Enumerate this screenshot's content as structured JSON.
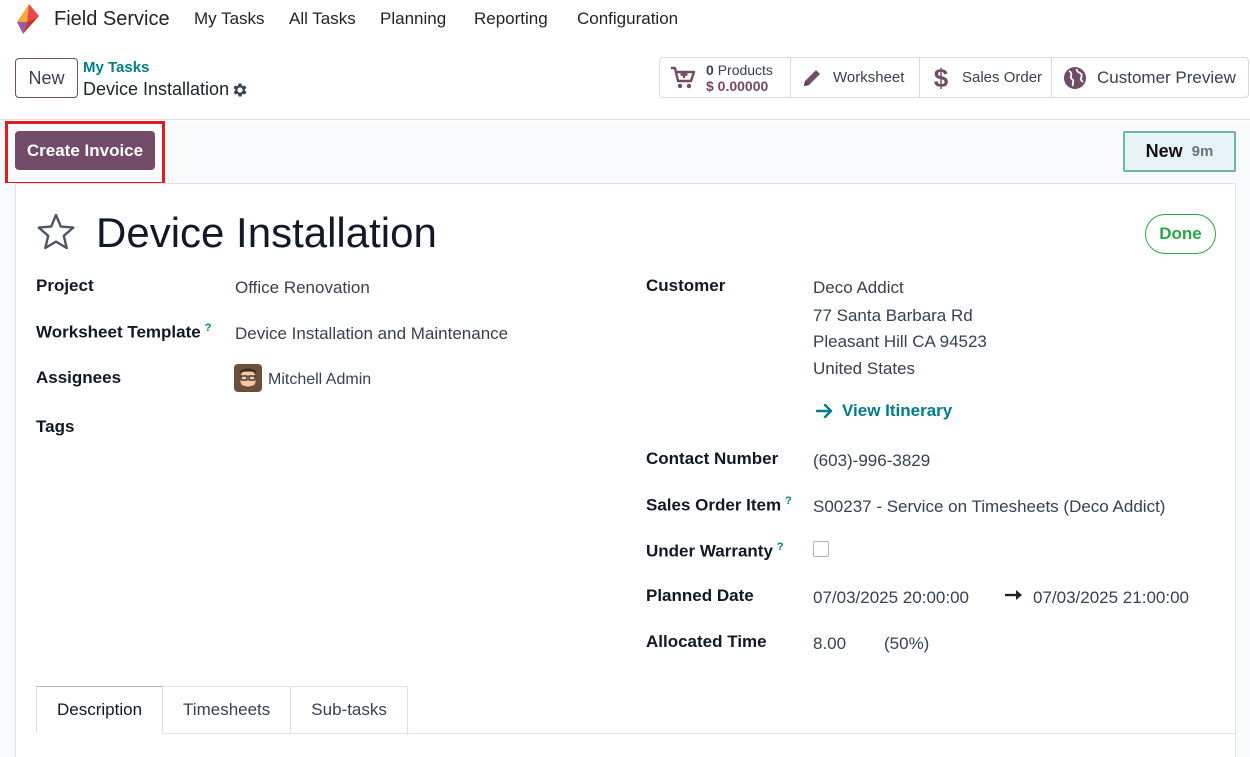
{
  "app": {
    "name": "Field Service",
    "menu": [
      "My Tasks",
      "All Tasks",
      "Planning",
      "Reporting",
      "Configuration"
    ]
  },
  "control_panel": {
    "new_label": "New",
    "breadcrumb_parent": "My Tasks",
    "breadcrumb_current": "Device Installation",
    "stats": {
      "products_count": "0",
      "products_label": "Products",
      "products_amount": "$ 0.00000",
      "worksheet": "Worksheet",
      "sales_order": "Sales Order",
      "customer_preview": "Customer Preview"
    }
  },
  "status": {
    "create_invoice": "Create Invoice",
    "stage": "New",
    "stage_duration": "9m"
  },
  "form": {
    "title": "Device Installation",
    "state": "Done",
    "left": {
      "project_label": "Project",
      "project": "Office Renovation",
      "worksheet_template_label": "Worksheet Template",
      "worksheet_template": "Device Installation and Maintenance",
      "assignees_label": "Assignees",
      "assignee": "Mitchell Admin",
      "tags_label": "Tags"
    },
    "right": {
      "customer_label": "Customer",
      "customer_name": "Deco Addict",
      "address_line1": "77 Santa Barbara Rd",
      "address_line2": "Pleasant Hill CA 94523",
      "address_country": "United States",
      "view_itinerary": "View Itinerary",
      "contact_label": "Contact Number",
      "contact": "(603)-996-3829",
      "sale_line_label": "Sales Order Item",
      "sale_line": "S00237 - Service on Timesheets (Deco Addict)",
      "warranty_label": "Under Warranty",
      "warranty_checked": false,
      "planned_label": "Planned Date",
      "planned_start": "07/03/2025 20:00:00",
      "planned_end": "07/03/2025 21:00:00",
      "allocated_label": "Allocated Time",
      "allocated_hours": "8.00",
      "allocated_percent": "(50%)"
    },
    "help_marker": "?",
    "tabs": [
      "Description",
      "Timesheets",
      "Sub-tasks"
    ]
  },
  "colors": {
    "brand": "#714b67",
    "teal": "#017e84",
    "done": "#28a745",
    "highlight": "#e01b24"
  }
}
